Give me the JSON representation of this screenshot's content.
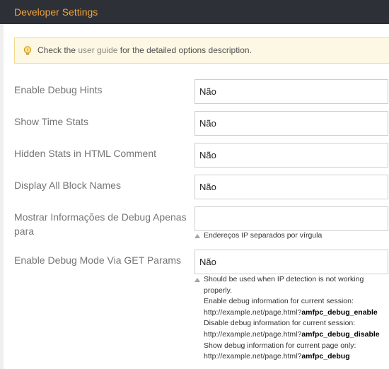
{
  "header": {
    "title": "Developer Settings"
  },
  "notice": {
    "icon": "lightbulb-icon",
    "text_before": "Check the",
    "link": "user guide",
    "text_after": "for the detailed options description."
  },
  "rows": [
    {
      "label": "Enable Debug Hints",
      "value": "Não"
    },
    {
      "label": "Show Time Stats",
      "value": "Não"
    },
    {
      "label": "Hidden Stats in HTML Comment",
      "value": "Não"
    },
    {
      "label": "Display All Block Names",
      "value": "Não"
    },
    {
      "label": "Mostrar Informações de Debug Apenas para",
      "value": "",
      "note": "Endereços IP separados por vírgula"
    },
    {
      "label": "Enable Debug Mode Via GET Params",
      "value": "Não"
    }
  ],
  "get_params_note": {
    "line1": "Should be used when IP detection is not working",
    "line2": "properly.",
    "line3": "Enable debug information for current session:",
    "url_prefix": "http://example.net/page.html?",
    "param_enable": "amfpc_debug_enable",
    "line5": "Disable debug information for current session:",
    "param_disable": "amfpc_debug_disable",
    "line7": "Show debug information for current page only:",
    "param_debug": "amfpc_debug"
  },
  "colors": {
    "accent": "#f2a33c",
    "header_bg": "#2d3036",
    "notice_bg": "#fdf8e3"
  }
}
